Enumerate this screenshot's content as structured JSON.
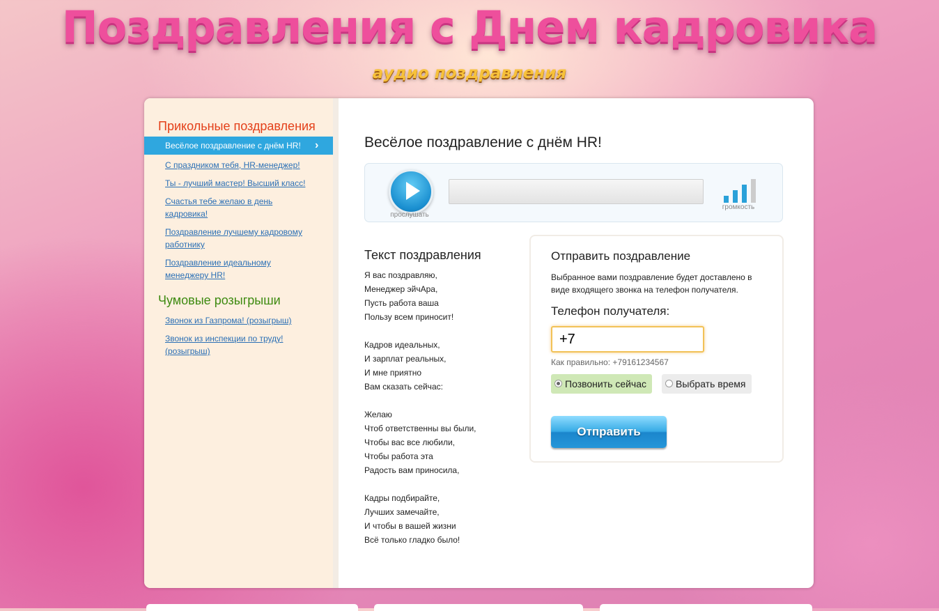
{
  "header": {
    "title": "Поздравления с Днем кадровика",
    "subtitle": "аудио поздравления"
  },
  "sidebar": {
    "categories": [
      {
        "title": "Прикольные поздравления",
        "items": [
          {
            "label": "Весёлое поздравление с днём HR!",
            "active": true
          },
          {
            "label": "С праздником тебя, HR-менеджер!"
          },
          {
            "label": "Ты - лучший мастер! Высший класс!"
          },
          {
            "label": "Счастья тебе желаю в день кадровика!"
          },
          {
            "label": "Поздравление лучшему кадровому работнику"
          },
          {
            "label": "Поздравление идеальному менеджеру HR!"
          }
        ]
      },
      {
        "title": "Чумовые розыгрыши",
        "items": [
          {
            "label": "Звонок из Газпрома! (розыгрыш)"
          },
          {
            "label": "Звонок из инспекции по труду! (розыгрыш)"
          }
        ]
      }
    ]
  },
  "main": {
    "song_title": "Весёлое поздравление с днём HR!",
    "player": {
      "play_label": "прослушать",
      "volume_label": "громкость",
      "progress_fraction": 0
    },
    "lyrics_heading": "Текст поздравления",
    "lyrics": "Я вас поздравляю,\nМенеджер эйчАра,\nПусть работа ваша\nПользу всем приносит!\n\nКадров идеальных,\nИ зарплат реальных,\nИ мне приятно\nВам сказать сейчас:\n\nЖелаю\nЧтоб ответственны вы были,\nЧтобы вас все любили,\nЧтобы работа эта\nРадость вам приносила,\n\nКадры подбирайте,\nЛучших замечайте,\nИ чтобы в вашей жизни\nВсё только гладко было!"
  },
  "send": {
    "heading": "Отправить поздравление",
    "description": "Выбранное вами поздравление будет доставлено в виде входящего звонка на телефон получателя.",
    "phone_label": "Телефон получателя:",
    "phone_value": "+7",
    "phone_hint": "Как правильно: +79161234567",
    "option_now": "Позвонить сейчас",
    "option_time": "Выбрать время",
    "submit_label": "Отправить"
  },
  "colors": {
    "accent": "#2fa7df",
    "category1": "#e4401a",
    "category2": "#3d8a10",
    "title_pink": "#ee4f9c",
    "subtitle_gold": "#f7c13a"
  }
}
